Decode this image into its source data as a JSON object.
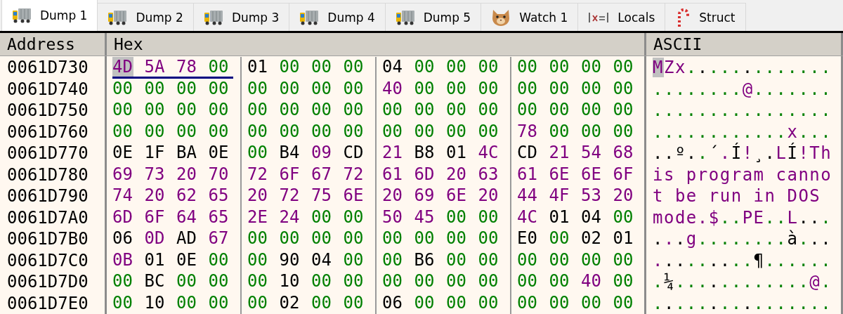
{
  "tabs": [
    {
      "label": "Dump 1",
      "kind": "dump",
      "selected": true
    },
    {
      "label": "Dump 2",
      "kind": "dump",
      "selected": false
    },
    {
      "label": "Dump 3",
      "kind": "dump",
      "selected": false
    },
    {
      "label": "Dump 4",
      "kind": "dump",
      "selected": false
    },
    {
      "label": "Dump 5",
      "kind": "dump",
      "selected": false
    },
    {
      "label": "Watch 1",
      "kind": "watch",
      "selected": false
    },
    {
      "label": "Locals",
      "kind": "locals",
      "selected": false
    },
    {
      "label": "Struct",
      "kind": "struct",
      "selected": false
    }
  ],
  "columns": [
    "Address",
    "Hex",
    "ASCII"
  ],
  "rows": [
    {
      "address": "0061D730",
      "groups": [
        {
          "underlined": true,
          "bytes": [
            {
              "hex": "4D",
              "char": "M",
              "kind": "text",
              "selected": true
            },
            {
              "hex": "5A",
              "char": "Z",
              "kind": "text",
              "selected": false
            },
            {
              "hex": "78",
              "char": "x",
              "kind": "text",
              "selected": false
            },
            {
              "hex": "00",
              "char": ".",
              "kind": "zero",
              "selected": false
            }
          ]
        },
        {
          "underlined": false,
          "bytes": [
            {
              "hex": "01",
              "char": ".",
              "kind": "other",
              "selected": false
            },
            {
              "hex": "00",
              "char": ".",
              "kind": "zero",
              "selected": false
            },
            {
              "hex": "00",
              "char": ".",
              "kind": "zero",
              "selected": false
            },
            {
              "hex": "00",
              "char": ".",
              "kind": "zero",
              "selected": false
            }
          ]
        },
        {
          "underlined": false,
          "bytes": [
            {
              "hex": "04",
              "char": ".",
              "kind": "other",
              "selected": false
            },
            {
              "hex": "00",
              "char": ".",
              "kind": "zero",
              "selected": false
            },
            {
              "hex": "00",
              "char": ".",
              "kind": "zero",
              "selected": false
            },
            {
              "hex": "00",
              "char": ".",
              "kind": "zero",
              "selected": false
            }
          ]
        },
        {
          "underlined": false,
          "bytes": [
            {
              "hex": "00",
              "char": ".",
              "kind": "zero",
              "selected": false
            },
            {
              "hex": "00",
              "char": ".",
              "kind": "zero",
              "selected": false
            },
            {
              "hex": "00",
              "char": ".",
              "kind": "zero",
              "selected": false
            },
            {
              "hex": "00",
              "char": ".",
              "kind": "zero",
              "selected": false
            }
          ]
        }
      ]
    },
    {
      "address": "0061D740",
      "groups": [
        {
          "underlined": false,
          "bytes": [
            {
              "hex": "00",
              "char": ".",
              "kind": "zero",
              "selected": false
            },
            {
              "hex": "00",
              "char": ".",
              "kind": "zero",
              "selected": false
            },
            {
              "hex": "00",
              "char": ".",
              "kind": "zero",
              "selected": false
            },
            {
              "hex": "00",
              "char": ".",
              "kind": "zero",
              "selected": false
            }
          ]
        },
        {
          "underlined": false,
          "bytes": [
            {
              "hex": "00",
              "char": ".",
              "kind": "zero",
              "selected": false
            },
            {
              "hex": "00",
              "char": ".",
              "kind": "zero",
              "selected": false
            },
            {
              "hex": "00",
              "char": ".",
              "kind": "zero",
              "selected": false
            },
            {
              "hex": "00",
              "char": ".",
              "kind": "zero",
              "selected": false
            }
          ]
        },
        {
          "underlined": false,
          "bytes": [
            {
              "hex": "40",
              "char": "@",
              "kind": "text",
              "selected": false
            },
            {
              "hex": "00",
              "char": ".",
              "kind": "zero",
              "selected": false
            },
            {
              "hex": "00",
              "char": ".",
              "kind": "zero",
              "selected": false
            },
            {
              "hex": "00",
              "char": ".",
              "kind": "zero",
              "selected": false
            }
          ]
        },
        {
          "underlined": false,
          "bytes": [
            {
              "hex": "00",
              "char": ".",
              "kind": "zero",
              "selected": false
            },
            {
              "hex": "00",
              "char": ".",
              "kind": "zero",
              "selected": false
            },
            {
              "hex": "00",
              "char": ".",
              "kind": "zero",
              "selected": false
            },
            {
              "hex": "00",
              "char": ".",
              "kind": "zero",
              "selected": false
            }
          ]
        }
      ]
    },
    {
      "address": "0061D750",
      "groups": [
        {
          "underlined": false,
          "bytes": [
            {
              "hex": "00",
              "char": ".",
              "kind": "zero",
              "selected": false
            },
            {
              "hex": "00",
              "char": ".",
              "kind": "zero",
              "selected": false
            },
            {
              "hex": "00",
              "char": ".",
              "kind": "zero",
              "selected": false
            },
            {
              "hex": "00",
              "char": ".",
              "kind": "zero",
              "selected": false
            }
          ]
        },
        {
          "underlined": false,
          "bytes": [
            {
              "hex": "00",
              "char": ".",
              "kind": "zero",
              "selected": false
            },
            {
              "hex": "00",
              "char": ".",
              "kind": "zero",
              "selected": false
            },
            {
              "hex": "00",
              "char": ".",
              "kind": "zero",
              "selected": false
            },
            {
              "hex": "00",
              "char": ".",
              "kind": "zero",
              "selected": false
            }
          ]
        },
        {
          "underlined": false,
          "bytes": [
            {
              "hex": "00",
              "char": ".",
              "kind": "zero",
              "selected": false
            },
            {
              "hex": "00",
              "char": ".",
              "kind": "zero",
              "selected": false
            },
            {
              "hex": "00",
              "char": ".",
              "kind": "zero",
              "selected": false
            },
            {
              "hex": "00",
              "char": ".",
              "kind": "zero",
              "selected": false
            }
          ]
        },
        {
          "underlined": false,
          "bytes": [
            {
              "hex": "00",
              "char": ".",
              "kind": "zero",
              "selected": false
            },
            {
              "hex": "00",
              "char": ".",
              "kind": "zero",
              "selected": false
            },
            {
              "hex": "00",
              "char": ".",
              "kind": "zero",
              "selected": false
            },
            {
              "hex": "00",
              "char": ".",
              "kind": "zero",
              "selected": false
            }
          ]
        }
      ]
    },
    {
      "address": "0061D760",
      "groups": [
        {
          "underlined": false,
          "bytes": [
            {
              "hex": "00",
              "char": ".",
              "kind": "zero",
              "selected": false
            },
            {
              "hex": "00",
              "char": ".",
              "kind": "zero",
              "selected": false
            },
            {
              "hex": "00",
              "char": ".",
              "kind": "zero",
              "selected": false
            },
            {
              "hex": "00",
              "char": ".",
              "kind": "zero",
              "selected": false
            }
          ]
        },
        {
          "underlined": false,
          "bytes": [
            {
              "hex": "00",
              "char": ".",
              "kind": "zero",
              "selected": false
            },
            {
              "hex": "00",
              "char": ".",
              "kind": "zero",
              "selected": false
            },
            {
              "hex": "00",
              "char": ".",
              "kind": "zero",
              "selected": false
            },
            {
              "hex": "00",
              "char": ".",
              "kind": "zero",
              "selected": false
            }
          ]
        },
        {
          "underlined": false,
          "bytes": [
            {
              "hex": "00",
              "char": ".",
              "kind": "zero",
              "selected": false
            },
            {
              "hex": "00",
              "char": ".",
              "kind": "zero",
              "selected": false
            },
            {
              "hex": "00",
              "char": ".",
              "kind": "zero",
              "selected": false
            },
            {
              "hex": "00",
              "char": ".",
              "kind": "zero",
              "selected": false
            }
          ]
        },
        {
          "underlined": false,
          "bytes": [
            {
              "hex": "78",
              "char": "x",
              "kind": "text",
              "selected": false
            },
            {
              "hex": "00",
              "char": ".",
              "kind": "zero",
              "selected": false
            },
            {
              "hex": "00",
              "char": ".",
              "kind": "zero",
              "selected": false
            },
            {
              "hex": "00",
              "char": ".",
              "kind": "zero",
              "selected": false
            }
          ]
        }
      ]
    },
    {
      "address": "0061D770",
      "groups": [
        {
          "underlined": false,
          "bytes": [
            {
              "hex": "0E",
              "char": ".",
              "kind": "other",
              "selected": false
            },
            {
              "hex": "1F",
              "char": ".",
              "kind": "other",
              "selected": false
            },
            {
              "hex": "BA",
              "char": "º",
              "kind": "other",
              "selected": false
            },
            {
              "hex": "0E",
              "char": ".",
              "kind": "other",
              "selected": false
            }
          ]
        },
        {
          "underlined": false,
          "bytes": [
            {
              "hex": "00",
              "char": ".",
              "kind": "zero",
              "selected": false
            },
            {
              "hex": "B4",
              "char": "´",
              "kind": "other",
              "selected": false
            },
            {
              "hex": "09",
              "char": ".",
              "kind": "text",
              "selected": false
            },
            {
              "hex": "CD",
              "char": "Í",
              "kind": "other",
              "selected": false
            }
          ]
        },
        {
          "underlined": false,
          "bytes": [
            {
              "hex": "21",
              "char": "!",
              "kind": "text",
              "selected": false
            },
            {
              "hex": "B8",
              "char": "¸",
              "kind": "other",
              "selected": false
            },
            {
              "hex": "01",
              "char": ".",
              "kind": "other",
              "selected": false
            },
            {
              "hex": "4C",
              "char": "L",
              "kind": "text",
              "selected": false
            }
          ]
        },
        {
          "underlined": false,
          "bytes": [
            {
              "hex": "CD",
              "char": "Í",
              "kind": "other",
              "selected": false
            },
            {
              "hex": "21",
              "char": "!",
              "kind": "text",
              "selected": false
            },
            {
              "hex": "54",
              "char": "T",
              "kind": "text",
              "selected": false
            },
            {
              "hex": "68",
              "char": "h",
              "kind": "text",
              "selected": false
            }
          ]
        }
      ]
    },
    {
      "address": "0061D780",
      "groups": [
        {
          "underlined": false,
          "bytes": [
            {
              "hex": "69",
              "char": "i",
              "kind": "text",
              "selected": false
            },
            {
              "hex": "73",
              "char": "s",
              "kind": "text",
              "selected": false
            },
            {
              "hex": "20",
              "kind": "text",
              "selected": false
            },
            {
              "hex": "70",
              "char": "p",
              "kind": "text",
              "selected": false
            }
          ]
        },
        {
          "underlined": false,
          "bytes": [
            {
              "hex": "72",
              "char": "r",
              "kind": "text",
              "selected": false
            },
            {
              "hex": "6F",
              "char": "o",
              "kind": "text",
              "selected": false
            },
            {
              "hex": "67",
              "char": "g",
              "kind": "text",
              "selected": false
            },
            {
              "hex": "72",
              "char": "r",
              "kind": "text",
              "selected": false
            }
          ]
        },
        {
          "underlined": false,
          "bytes": [
            {
              "hex": "61",
              "char": "a",
              "kind": "text",
              "selected": false
            },
            {
              "hex": "6D",
              "char": "m",
              "kind": "text",
              "selected": false
            },
            {
              "hex": "20",
              "kind": "text",
              "selected": false
            },
            {
              "hex": "63",
              "char": "c",
              "kind": "text",
              "selected": false
            }
          ]
        },
        {
          "underlined": false,
          "bytes": [
            {
              "hex": "61",
              "char": "a",
              "kind": "text",
              "selected": false
            },
            {
              "hex": "6E",
              "char": "n",
              "kind": "text",
              "selected": false
            },
            {
              "hex": "6E",
              "char": "n",
              "kind": "text",
              "selected": false
            },
            {
              "hex": "6F",
              "char": "o",
              "kind": "text",
              "selected": false
            }
          ]
        }
      ]
    },
    {
      "address": "0061D790",
      "groups": [
        {
          "underlined": false,
          "bytes": [
            {
              "hex": "74",
              "char": "t",
              "kind": "text",
              "selected": false
            },
            {
              "hex": "20",
              "kind": "text",
              "selected": false
            },
            {
              "hex": "62",
              "char": "b",
              "kind": "text",
              "selected": false
            },
            {
              "hex": "65",
              "char": "e",
              "kind": "text",
              "selected": false
            }
          ]
        },
        {
          "underlined": false,
          "bytes": [
            {
              "hex": "20",
              "kind": "text",
              "selected": false
            },
            {
              "hex": "72",
              "char": "r",
              "kind": "text",
              "selected": false
            },
            {
              "hex": "75",
              "char": "u",
              "kind": "text",
              "selected": false
            },
            {
              "hex": "6E",
              "char": "n",
              "kind": "text",
              "selected": false
            }
          ]
        },
        {
          "underlined": false,
          "bytes": [
            {
              "hex": "20",
              "kind": "text",
              "selected": false
            },
            {
              "hex": "69",
              "char": "i",
              "kind": "text",
              "selected": false
            },
            {
              "hex": "6E",
              "char": "n",
              "kind": "text",
              "selected": false
            },
            {
              "hex": "20",
              "kind": "text",
              "selected": false
            }
          ]
        },
        {
          "underlined": false,
          "bytes": [
            {
              "hex": "44",
              "char": "D",
              "kind": "text",
              "selected": false
            },
            {
              "hex": "4F",
              "char": "O",
              "kind": "text",
              "selected": false
            },
            {
              "hex": "53",
              "char": "S",
              "kind": "text",
              "selected": false
            },
            {
              "hex": "20",
              "kind": "text",
              "selected": false
            }
          ]
        }
      ]
    },
    {
      "address": "0061D7A0",
      "groups": [
        {
          "underlined": false,
          "bytes": [
            {
              "hex": "6D",
              "char": "m",
              "kind": "text",
              "selected": false
            },
            {
              "hex": "6F",
              "char": "o",
              "kind": "text",
              "selected": false
            },
            {
              "hex": "64",
              "char": "d",
              "kind": "text",
              "selected": false
            },
            {
              "hex": "65",
              "char": "e",
              "kind": "text",
              "selected": false
            }
          ]
        },
        {
          "underlined": false,
          "bytes": [
            {
              "hex": "2E",
              "char": ".",
              "kind": "text",
              "selected": false
            },
            {
              "hex": "24",
              "char": "$",
              "kind": "text",
              "selected": false
            },
            {
              "hex": "00",
              "char": ".",
              "kind": "zero",
              "selected": false
            },
            {
              "hex": "00",
              "char": ".",
              "kind": "zero",
              "selected": false
            }
          ]
        },
        {
          "underlined": false,
          "bytes": [
            {
              "hex": "50",
              "char": "P",
              "kind": "text",
              "selected": false
            },
            {
              "hex": "45",
              "char": "E",
              "kind": "text",
              "selected": false
            },
            {
              "hex": "00",
              "char": ".",
              "kind": "zero",
              "selected": false
            },
            {
              "hex": "00",
              "char": ".",
              "kind": "zero",
              "selected": false
            }
          ]
        },
        {
          "underlined": false,
          "bytes": [
            {
              "hex": "4C",
              "char": "L",
              "kind": "text",
              "selected": false
            },
            {
              "hex": "01",
              "char": ".",
              "kind": "other",
              "selected": false
            },
            {
              "hex": "04",
              "char": ".",
              "kind": "other",
              "selected": false
            },
            {
              "hex": "00",
              "char": ".",
              "kind": "zero",
              "selected": false
            }
          ]
        }
      ]
    },
    {
      "address": "0061D7B0",
      "groups": [
        {
          "underlined": false,
          "bytes": [
            {
              "hex": "06",
              "char": ".",
              "kind": "other",
              "selected": false
            },
            {
              "hex": "0D",
              "char": ".",
              "kind": "text",
              "selected": false
            },
            {
              "hex": "AD",
              "char": ".",
              "kind": "other",
              "selected": false
            },
            {
              "hex": "67",
              "char": "g",
              "kind": "text",
              "selected": false
            }
          ]
        },
        {
          "underlined": false,
          "bytes": [
            {
              "hex": "00",
              "char": ".",
              "kind": "zero",
              "selected": false
            },
            {
              "hex": "00",
              "char": ".",
              "kind": "zero",
              "selected": false
            },
            {
              "hex": "00",
              "char": ".",
              "kind": "zero",
              "selected": false
            },
            {
              "hex": "00",
              "char": ".",
              "kind": "zero",
              "selected": false
            }
          ]
        },
        {
          "underlined": false,
          "bytes": [
            {
              "hex": "00",
              "char": ".",
              "kind": "zero",
              "selected": false
            },
            {
              "hex": "00",
              "char": ".",
              "kind": "zero",
              "selected": false
            },
            {
              "hex": "00",
              "char": ".",
              "kind": "zero",
              "selected": false
            },
            {
              "hex": "00",
              "char": ".",
              "kind": "zero",
              "selected": false
            }
          ]
        },
        {
          "underlined": false,
          "bytes": [
            {
              "hex": "E0",
              "char": "à",
              "kind": "other",
              "selected": false
            },
            {
              "hex": "00",
              "char": ".",
              "kind": "zero",
              "selected": false
            },
            {
              "hex": "02",
              "char": ".",
              "kind": "other",
              "selected": false
            },
            {
              "hex": "01",
              "char": ".",
              "kind": "other",
              "selected": false
            }
          ]
        }
      ]
    },
    {
      "address": "0061D7C0",
      "groups": [
        {
          "underlined": false,
          "bytes": [
            {
              "hex": "0B",
              "char": ".",
              "kind": "text",
              "selected": false
            },
            {
              "hex": "01",
              "char": ".",
              "kind": "other",
              "selected": false
            },
            {
              "hex": "0E",
              "char": ".",
              "kind": "other",
              "selected": false
            },
            {
              "hex": "00",
              "char": ".",
              "kind": "zero",
              "selected": false
            }
          ]
        },
        {
          "underlined": false,
          "bytes": [
            {
              "hex": "00",
              "char": ".",
              "kind": "zero",
              "selected": false
            },
            {
              "hex": "90",
              "char": ".",
              "kind": "other",
              "selected": false
            },
            {
              "hex": "04",
              "char": ".",
              "kind": "other",
              "selected": false
            },
            {
              "hex": "00",
              "char": ".",
              "kind": "zero",
              "selected": false
            }
          ]
        },
        {
          "underlined": false,
          "bytes": [
            {
              "hex": "00",
              "char": ".",
              "kind": "zero",
              "selected": false
            },
            {
              "hex": "B6",
              "char": "¶",
              "kind": "other",
              "selected": false
            },
            {
              "hex": "00",
              "char": ".",
              "kind": "zero",
              "selected": false
            },
            {
              "hex": "00",
              "char": ".",
              "kind": "zero",
              "selected": false
            }
          ]
        },
        {
          "underlined": false,
          "bytes": [
            {
              "hex": "00",
              "char": ".",
              "kind": "zero",
              "selected": false
            },
            {
              "hex": "00",
              "char": ".",
              "kind": "zero",
              "selected": false
            },
            {
              "hex": "00",
              "char": ".",
              "kind": "zero",
              "selected": false
            },
            {
              "hex": "00",
              "char": ".",
              "kind": "zero",
              "selected": false
            }
          ]
        }
      ]
    },
    {
      "address": "0061D7D0",
      "groups": [
        {
          "underlined": false,
          "bytes": [
            {
              "hex": "00",
              "char": ".",
              "kind": "zero",
              "selected": false
            },
            {
              "hex": "BC",
              "char": "¼",
              "kind": "other",
              "selected": false
            },
            {
              "hex": "00",
              "char": ".",
              "kind": "zero",
              "selected": false
            },
            {
              "hex": "00",
              "char": ".",
              "kind": "zero",
              "selected": false
            }
          ]
        },
        {
          "underlined": false,
          "bytes": [
            {
              "hex": "00",
              "char": ".",
              "kind": "zero",
              "selected": false
            },
            {
              "hex": "10",
              "char": ".",
              "kind": "other",
              "selected": false
            },
            {
              "hex": "00",
              "char": ".",
              "kind": "zero",
              "selected": false
            },
            {
              "hex": "00",
              "char": ".",
              "kind": "zero",
              "selected": false
            }
          ]
        },
        {
          "underlined": false,
          "bytes": [
            {
              "hex": "00",
              "char": ".",
              "kind": "zero",
              "selected": false
            },
            {
              "hex": "00",
              "char": ".",
              "kind": "zero",
              "selected": false
            },
            {
              "hex": "00",
              "char": ".",
              "kind": "zero",
              "selected": false
            },
            {
              "hex": "00",
              "char": ".",
              "kind": "zero",
              "selected": false
            }
          ]
        },
        {
          "underlined": false,
          "bytes": [
            {
              "hex": "00",
              "char": ".",
              "kind": "zero",
              "selected": false
            },
            {
              "hex": "00",
              "char": ".",
              "kind": "zero",
              "selected": false
            },
            {
              "hex": "40",
              "char": "@",
              "kind": "text",
              "selected": false
            },
            {
              "hex": "00",
              "char": ".",
              "kind": "zero",
              "selected": false
            }
          ]
        }
      ]
    },
    {
      "address": "0061D7E0",
      "groups": [
        {
          "underlined": false,
          "bytes": [
            {
              "hex": "00",
              "char": ".",
              "kind": "zero",
              "selected": false
            },
            {
              "hex": "10",
              "char": ".",
              "kind": "other",
              "selected": false
            },
            {
              "hex": "00",
              "char": ".",
              "kind": "zero",
              "selected": false
            },
            {
              "hex": "00",
              "char": ".",
              "kind": "zero",
              "selected": false
            }
          ]
        },
        {
          "underlined": false,
          "bytes": [
            {
              "hex": "00",
              "char": ".",
              "kind": "zero",
              "selected": false
            },
            {
              "hex": "02",
              "char": ".",
              "kind": "other",
              "selected": false
            },
            {
              "hex": "00",
              "char": ".",
              "kind": "zero",
              "selected": false
            },
            {
              "hex": "00",
              "char": ".",
              "kind": "zero",
              "selected": false
            }
          ]
        },
        {
          "underlined": false,
          "bytes": [
            {
              "hex": "06",
              "char": ".",
              "kind": "other",
              "selected": false
            },
            {
              "hex": "00",
              "char": ".",
              "kind": "zero",
              "selected": false
            },
            {
              "hex": "00",
              "char": ".",
              "kind": "zero",
              "selected": false
            },
            {
              "hex": "00",
              "char": ".",
              "kind": "zero",
              "selected": false
            }
          ]
        },
        {
          "underlined": false,
          "bytes": [
            {
              "hex": "00",
              "char": ".",
              "kind": "zero",
              "selected": false
            },
            {
              "hex": "00",
              "char": ".",
              "kind": "zero",
              "selected": false
            },
            {
              "hex": "00",
              "char": ".",
              "kind": "zero",
              "selected": false
            },
            {
              "hex": "00",
              "char": ".",
              "kind": "zero",
              "selected": false
            }
          ]
        }
      ]
    }
  ]
}
